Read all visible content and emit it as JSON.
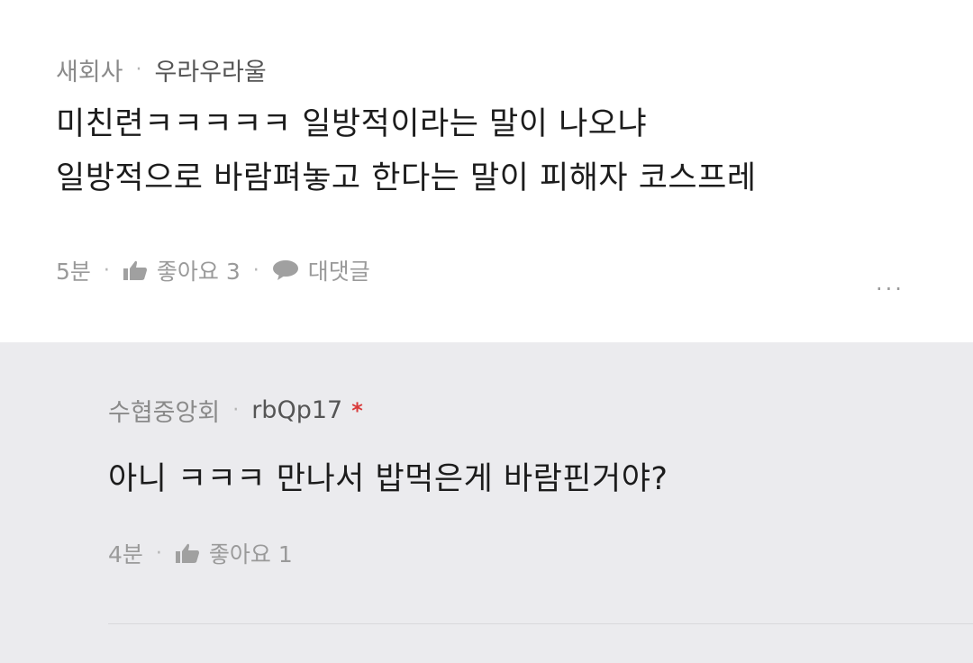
{
  "comments": [
    {
      "organization": "새회사",
      "author": "우라우라울",
      "lines": [
        "미친련ㅋㅋㅋㅋㅋ 일방적이라는 말이 나오냐",
        "일방적으로 바람펴놓고 한다는 말이 피해자 코스프레"
      ],
      "time": "5분",
      "like_label": "좋아요 3",
      "reply_label": "대댓글",
      "more_label": "..."
    },
    {
      "organization": "수협중앙회",
      "author": "rbQp17",
      "author_mark": "*",
      "lines": [
        "아니 ㅋㅋㅋ 만나서 밥먹은게 바람핀거야?"
      ],
      "time": "4분",
      "like_label": "좋아요 1"
    }
  ],
  "icons": {
    "like": "thumbs-up-icon",
    "reply": "speech-bubble-icon",
    "more": "more-dots-icon"
  },
  "colors": {
    "reply_background": "#ebebee",
    "author_mark": "#d93a3a"
  }
}
